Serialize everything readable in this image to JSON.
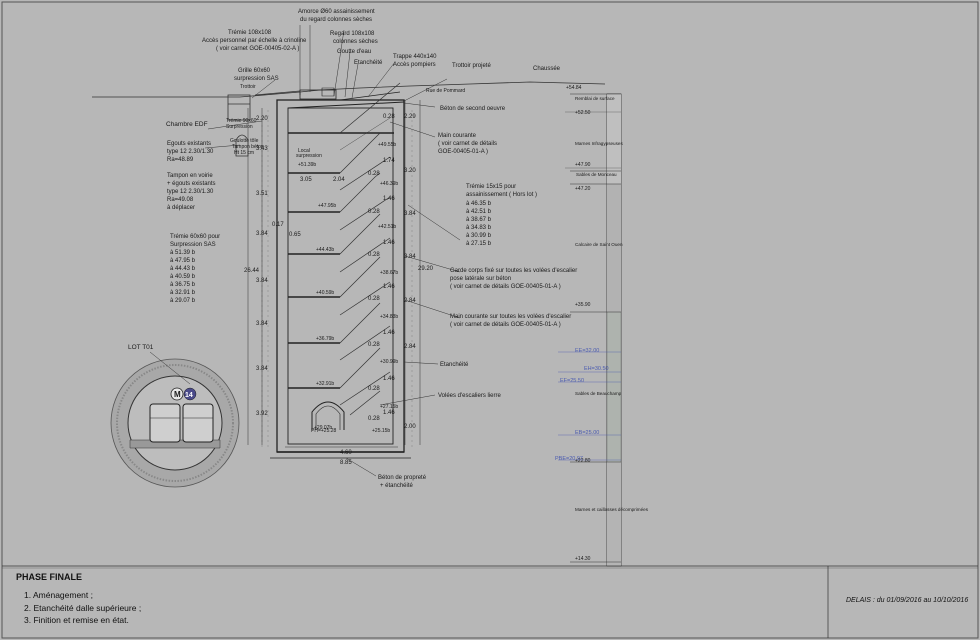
{
  "drawing": {
    "labels": {
      "amorce": [
        "Amorce Ø60 assainissement",
        "du regard colonnes sèches"
      ],
      "tremie108": [
        "Trémie 108x108",
        "Accès personnel par échelle à crinoline",
        "( voir carnet GOE-00405-02-A )"
      ],
      "regard": [
        "Regard 108x108",
        "colonnes sèches"
      ],
      "goutte": "Goutte d'eau",
      "etancheite_top": "Etanchéité",
      "trappe": [
        "Trappe 440x140",
        "Accès pompiers"
      ],
      "trottoir": "Trottoir projeté",
      "chaussee": "Chaussée",
      "grille": [
        "Grille 60x60",
        "surpression SAS"
      ],
      "beton_second": "Béton de second oeuvre",
      "chambre_edf": "Chambre EDF",
      "egouts": [
        "Egouts existants",
        "type 12 2.30/1.30",
        "Ra=48.89"
      ],
      "tampon": [
        "Tampon en voirie",
        "+ égouts existants",
        "type 12 2.30/1.30",
        "Ra=49.08",
        "à déplacer"
      ],
      "tremie60": [
        "Trémie 60x60 pour",
        "Surpression SAS",
        "à 51.39 b",
        "à 47.95 b",
        "à 44.43 b",
        "à 40.59 b",
        "à 36.75 b",
        "à 32.91 b",
        "à 29.07 b"
      ],
      "main_courante": [
        "Main courante",
        "( voir carnet de détails",
        "GOE-00405-01-A )"
      ],
      "tremie15": [
        "Trémie 15x15 pour",
        "assainissement ( Hors lot )",
        "à 46.35 b",
        "à 42.51 b",
        "à 38.67 b",
        "à 34.83 b",
        "à 30.99 b",
        "à 27.15 b"
      ],
      "garde_corps": [
        "Garde corps fixé sur toutes les volées d'escalier",
        "pose latérale sur béton",
        "( voir carnet de détails GOE-00405-01-A )"
      ],
      "main_courante_all": [
        "Main courante sur toutes les volées d'escalier",
        "( voir carnet de détails GOE-00405-01-A )"
      ],
      "etancheite_mid": "Etanchéité",
      "volees": "Volées d'escaliers lierre",
      "beton_propre": [
        "Béton de propreté",
        "+ étanchéité"
      ],
      "lot": "LOT T01",
      "metro_m": "M",
      "metro_line": "14",
      "local": [
        "Local",
        "surpression"
      ],
      "trottoir_small": "Trottoir",
      "rue": "Rue de Pommard",
      "tremie_small": [
        "Trémie 90x60",
        "Surpression"
      ],
      "goulotte": [
        "Goulotte tôle",
        "Tampon béton",
        "Ht 15 cm"
      ],
      "phi": "PH=+25.28",
      "width_bottom": "8.85"
    },
    "landings": [
      "+51.39b",
      "+47.95b",
      "+44.43b",
      "+40.59b",
      "+36.79b",
      "+32.91b",
      "+29.07b",
      "PH=+25.28"
    ],
    "stair_marks": [
      "+49.55b",
      "+46.39b",
      "+42.51b",
      "+38.67b",
      "+34.83b",
      "+30.99b",
      "+27.15b",
      "+25.15b"
    ],
    "left_dims": [
      "2.20",
      "3.43",
      "3.51",
      "3.84",
      "3.84",
      "3.84",
      "3.84",
      "3.92"
    ],
    "right_dims": [
      "2.29",
      "3.20",
      "3.84",
      "3.84",
      "2.84",
      "2.84",
      "2.00"
    ],
    "step_dims": [
      "0.28",
      "1.74",
      "0.28",
      "1.46",
      "0.28",
      "1.46",
      "0.28",
      "1.46",
      "0.28",
      "1.46",
      "0.28",
      "1.46",
      "0.28",
      "1.46",
      "0.28"
    ],
    "misc_dims": [
      "3.05",
      "2.04",
      "0.17",
      "0.65",
      "26.44",
      "29.20",
      "4.60"
    ],
    "geology": {
      "levels": [
        "+54.84",
        "+52.50",
        "+47.90",
        "+47.20",
        "+35.90",
        "+22.80",
        "+14.30"
      ],
      "layers": [
        "Remblai de surface",
        "Marnes Infragypseuses",
        "Sables de Monceau",
        "Calcaire de Saint Ouen",
        "Sables de Beauchamp",
        "Marnes et caillasses décomprimées"
      ],
      "water": [
        "EE=32.00",
        "EH=30.50",
        "EF=25.50",
        "EB=25.00",
        "PBE=20.97"
      ]
    }
  },
  "footer": {
    "phase_title": "PHASE FINALE",
    "steps": [
      "Aménagement ;",
      "Etanchéité dalle supérieure ;",
      "Finition et remise en état."
    ],
    "delay_prefix": "DELAIS : du 01/09/2016 au 10/10/2016"
  }
}
